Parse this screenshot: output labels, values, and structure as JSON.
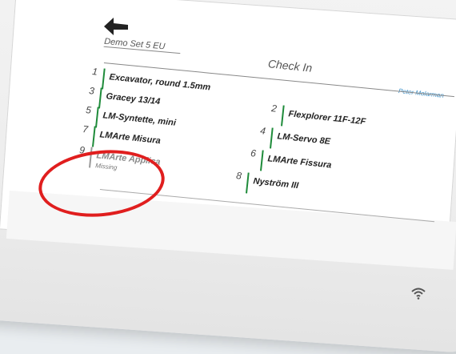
{
  "header": {
    "set_name": "Demo Set 5 EU",
    "title": "Check In",
    "user": "Peter Molarman"
  },
  "icons": {
    "back": "back-arrow-icon",
    "wifi": "wifi-icon"
  },
  "colors": {
    "checked_bar": "#1e8b3a",
    "missing_bar": "#9a9a9a",
    "user_link": "#3a8fc8",
    "annotation_ring": "#e01e1e"
  },
  "left_items": [
    {
      "num": "1",
      "label": "Excavator, round 1.5mm",
      "status": ""
    },
    {
      "num": "3",
      "label": "Gracey 13/14",
      "status": ""
    },
    {
      "num": "5",
      "label": "LM-Syntette, mini",
      "status": ""
    },
    {
      "num": "7",
      "label": "LMArte Misura",
      "status": ""
    },
    {
      "num": "9",
      "label": "LMArte Applica",
      "status": "Missing"
    }
  ],
  "right_items": [
    {
      "num": "2",
      "label": "Flexplorer 11F-12F",
      "status": ""
    },
    {
      "num": "4",
      "label": "LM-Servo 8E",
      "status": ""
    },
    {
      "num": "6",
      "label": "LMArte Fissura",
      "status": ""
    },
    {
      "num": "8",
      "label": "Nyström III",
      "status": ""
    }
  ]
}
